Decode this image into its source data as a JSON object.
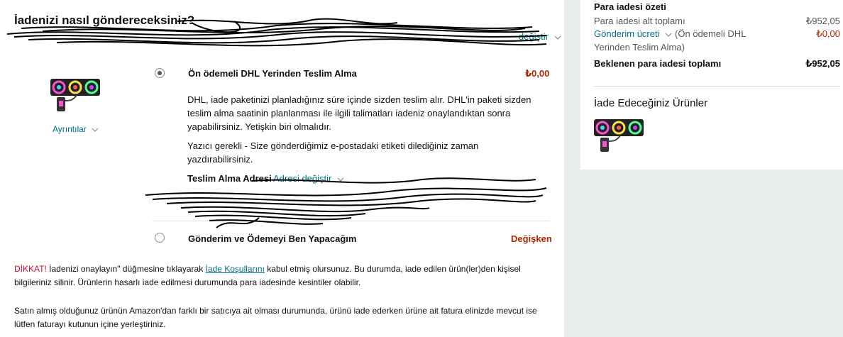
{
  "main": {
    "heading": "İadenizi nasıl göndereceksiniz?",
    "change_link": "değiştir",
    "details_link": "Ayrıntılar",
    "option1": {
      "title": "Ön ödemeli DHL Yerinden Teslim Alma",
      "price": "₺0,00",
      "description": "DHL, iade paketinizi planladığınız süre içinde sizden teslim alır. DHL'in paketi sizden teslim alma saatinin planlanması ile ilgili talimatları iadeniz onaylandıktan sonra yapabilirsiniz. Yetişkin biri olmalıdır.",
      "printer_note": "Yazıcı gerekli - Size gönderdiğimiz e-postadaki etiketi dilediğiniz zaman yazdırabilirsiniz.",
      "pickup_address_label": "Teslim Alma Adresi",
      "change_address_link": "Adresi değiştir"
    },
    "option2": {
      "title": "Gönderim ve Ödemeyi Ben Yapacağım",
      "price": "Değişken"
    },
    "notice": {
      "warning": "DİKKAT!",
      "text_before_link": "İadenizi onaylayın\" düğmesine tıklayarak",
      "link": "İade Koşullarını",
      "text_after_link": "kabul etmiş olursunuz. Bu durumda, iade edilen ürün(ler)den kişisel bilgileriniz silinir. Ürünlerin hasarlı iade edilmesi durumunda para iadesinde kesintiler olabilir."
    },
    "invoice_note": "Satın almış olduğunuz ürünün Amazon'dan farklı bir satıcıya ait olması durumunda, ürünü iade ederken ürüne ait fatura elinizde mevcut ise lütfen faturayı kutunun içine yerleştiriniz."
  },
  "summary": {
    "title": "Para iadesi özeti",
    "subtotal_label": "Para iadesi alt toplamı",
    "subtotal_value": "₺952,05",
    "shipping_link": "Gönderim ücreti",
    "shipping_note": "(Ön ödemeli DHL Yerinden Teslim Alma)",
    "shipping_value": "₺0,00",
    "total_label": "Beklenen para iadesi toplamı",
    "total_value": "₺952,05",
    "items_title": "İade Edeceğiniz Ürünler"
  },
  "colors": {
    "link": "#007185",
    "price": "#b12704",
    "warning": "#cc0c39",
    "page_bg": "#eaeded"
  }
}
